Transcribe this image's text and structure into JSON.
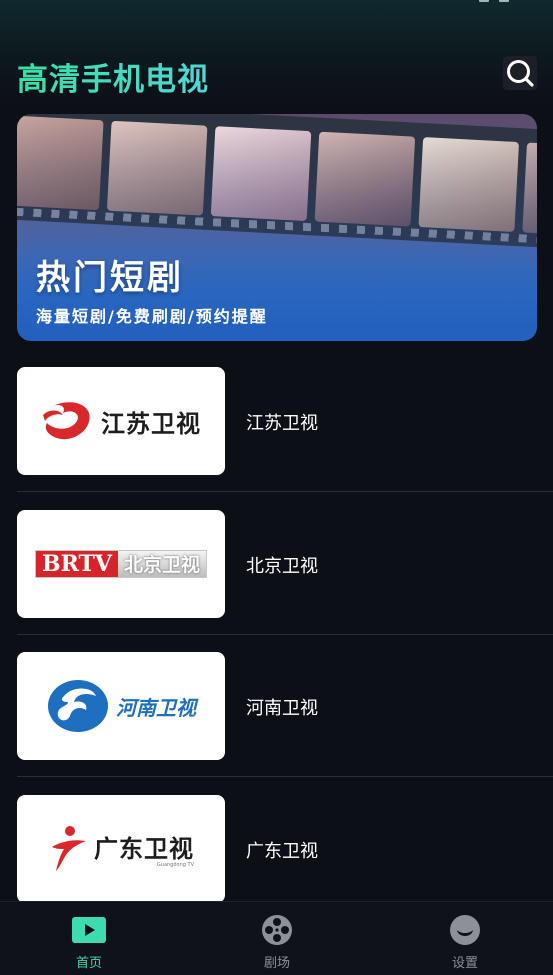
{
  "app": {
    "title": "高清手机电视"
  },
  "header": {
    "search_icon": "search-icon"
  },
  "banner": {
    "title": "热门短剧",
    "subtitle": "海量短剧/免费刷剧/预约提醒"
  },
  "channels": [
    {
      "name": "江苏卫视",
      "logo_text": "江苏卫视"
    },
    {
      "name": "北京卫视",
      "logo_left": "BRTV",
      "logo_right": "北京卫视"
    },
    {
      "name": "河南卫视",
      "logo_text": "河南卫视"
    },
    {
      "name": "广东卫视",
      "logo_text": "广东卫视",
      "logo_sub": "Guangdong TV"
    }
  ],
  "tabs": [
    {
      "label": "首页",
      "icon": "play-icon",
      "active": true
    },
    {
      "label": "剧场",
      "icon": "film-reel-icon",
      "active": false
    },
    {
      "label": "设置",
      "icon": "smile-icon",
      "active": false
    }
  ],
  "colors": {
    "accent": "#3ddcae",
    "background": "#0c0f16",
    "tab_inactive": "#8c9097"
  }
}
